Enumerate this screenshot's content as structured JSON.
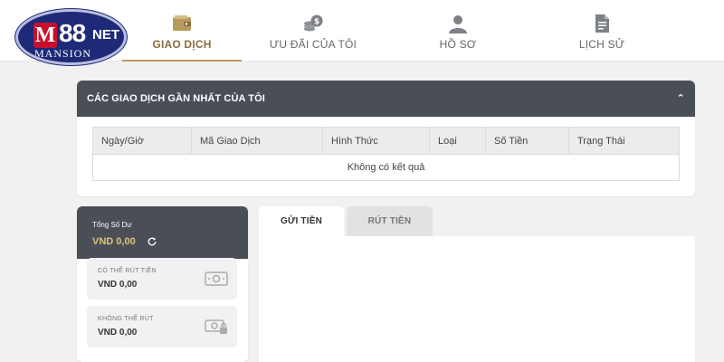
{
  "brand": {
    "logo_m": "M",
    "logo_88": "88",
    "logo_net": "NET",
    "logo_mansion": "MANSION"
  },
  "nav": {
    "items": [
      {
        "label": "GIAO DỊCH",
        "icon": "wallet-icon",
        "active": true
      },
      {
        "label": "ƯU ĐÃI CỦA TÔI",
        "icon": "coins-icon",
        "active": false
      },
      {
        "label": "HỒ SƠ",
        "icon": "user-icon",
        "active": false
      },
      {
        "label": "LỊCH SỬ",
        "icon": "document-icon",
        "active": false
      }
    ]
  },
  "recent": {
    "title": "CÁC GIAO DỊCH GẦN NHẤT CỦA TÔI",
    "collapse_icon": "chevron-up-icon",
    "columns": [
      "Ngày/Giờ",
      "Mã Giao Dịch",
      "Hình Thức",
      "Loại",
      "Số Tiền",
      "Trạng Thái"
    ],
    "empty_text": "Không có kết quả"
  },
  "balance": {
    "title": "Tổng Số Dư",
    "value": "VND 0,00",
    "refresh_icon": "refresh-icon",
    "withdrawable": {
      "label": "CÓ THỂ RÚT TIỀN",
      "value": "VND 0,00",
      "icon": "cash-icon"
    },
    "non_withdrawable": {
      "label": "KHÔNG THỂ RÚT",
      "value": "VND 0,00",
      "icon": "locked-cash-icon"
    }
  },
  "tabs": [
    {
      "label": "GỬI TIỀN",
      "active": true
    },
    {
      "label": "RÚT TIỀN",
      "active": false
    }
  ],
  "colors": {
    "header_dark": "#4a4e57",
    "accent_gold": "#b89a5c",
    "balance_gold": "#e0c27a",
    "logo_blue": "#1e2a78",
    "logo_red": "#c8102e"
  }
}
